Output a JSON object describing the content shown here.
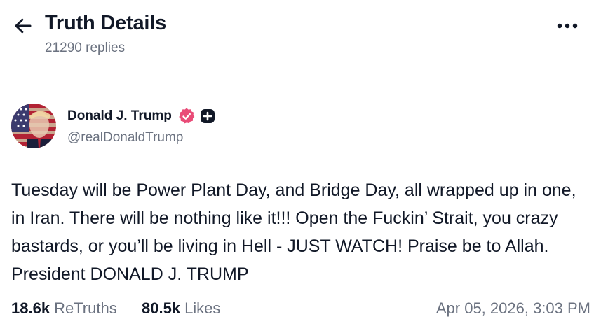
{
  "header": {
    "title": "Truth Details",
    "replies_text": "21290 replies",
    "back_icon": "arrow-left-icon",
    "more_icon": "more-horizontal-icon"
  },
  "post": {
    "author": {
      "name": "Donald J. Trump",
      "handle": "@realDonaldTrump",
      "verified_color": "#e94b77"
    },
    "body": "Tuesday will be Power Plant Day, and Bridge Day, all wrapped up in one, in Iran. There will be nothing like it!!! Open the Fuckin’ Strait, you crazy bastards, or you’ll be living in Hell - JUST WATCH! Praise be to Allah. President DONALD J. TRUMP",
    "retruths": {
      "count": "18.6k",
      "label": "ReTruths"
    },
    "likes": {
      "count": "80.5k",
      "label": "Likes"
    },
    "timestamp": "Apr 05, 2026, 3:03 PM"
  }
}
